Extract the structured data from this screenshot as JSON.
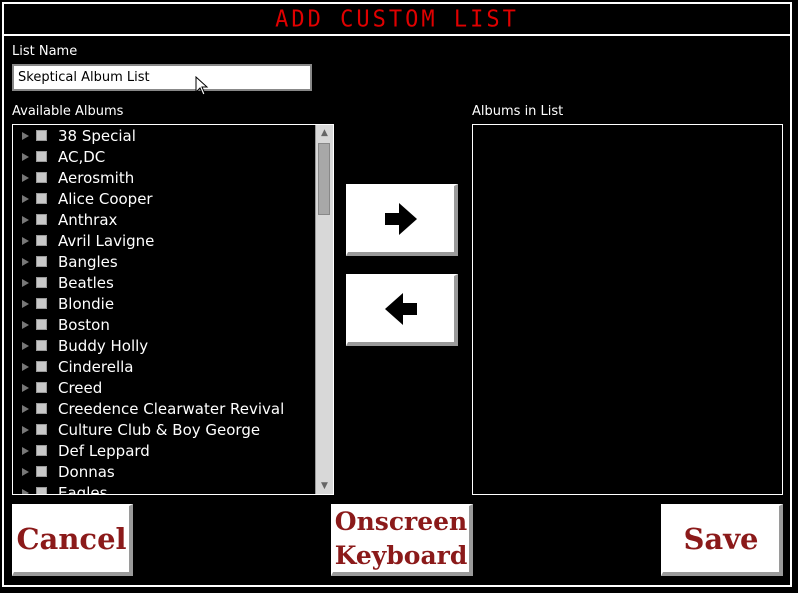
{
  "window": {
    "title": "ADD CUSTOM LIST"
  },
  "list_name": {
    "label": "List Name",
    "value": "Skeptical Album List"
  },
  "available": {
    "label": "Available Albums",
    "items": [
      "38 Special",
      "AC,DC",
      "Aerosmith",
      "Alice Cooper",
      "Anthrax",
      "Avril Lavigne",
      "Bangles",
      "Beatles",
      "Blondie",
      "Boston",
      "Buddy Holly",
      "Cinderella",
      "Creed",
      "Creedence Clearwater Revival",
      "Culture Club & Boy George",
      "Def Leppard",
      "Donnas",
      "Eagles"
    ]
  },
  "in_list": {
    "label": "Albums in List"
  },
  "buttons": {
    "cancel": "Cancel",
    "keyboard": "Onscreen Keyboard",
    "save": "Save"
  },
  "icons": {
    "add": "arrow-right-icon",
    "remove": "arrow-left-icon",
    "expander": "triangle-right-icon"
  },
  "colors": {
    "title": "#e00000",
    "button_text": "#8b1a1a",
    "background": "#000000"
  }
}
